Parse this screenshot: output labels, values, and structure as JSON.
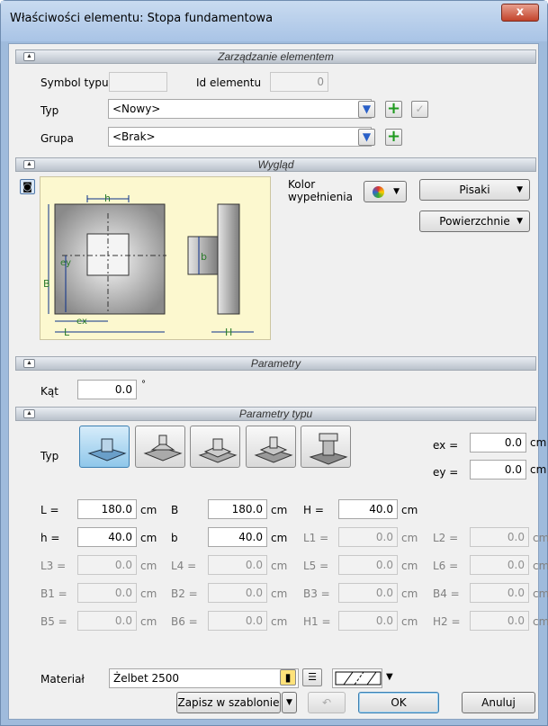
{
  "window": {
    "title": "Właściwości elementu: Stopa fundamentowa",
    "close_glyph": "x"
  },
  "sections": {
    "zarzadzanie": "Zarządzanie elementem",
    "wyglad": "Wygląd",
    "parametry": "Parametry",
    "parametry_typu": "Parametry typu"
  },
  "zarzadzanie": {
    "symbol_label": "Symbol typu",
    "symbol_value": "",
    "id_label": "Id elementu",
    "id_value": "0",
    "typ_label": "Typ",
    "typ_value": "<Nowy>",
    "grupa_label": "Grupa",
    "grupa_value": "<Brak>"
  },
  "wyglad": {
    "kolor_label_1": "Kolor",
    "kolor_label_2": "wypełnienia",
    "pisaki_label": "Pisaki",
    "powierzchnie_label": "Powierzchnie",
    "diagram_labels": {
      "h": "h",
      "b": "b",
      "B": "B",
      "ey": "ey",
      "ex": "ex",
      "L": "L",
      "H": "H"
    }
  },
  "parametry": {
    "kat_label": "Kąt",
    "kat_value": "0.0",
    "kat_unit": "°"
  },
  "parametry_typu": {
    "typ_label": "Typ",
    "ex_label": "ex =",
    "ex_value": "0.0",
    "ex_unit": "cm",
    "ey_label": "ey =",
    "ey_value": "0.0",
    "ey_unit": "cm",
    "params": [
      {
        "label": "L =",
        "value": "180.0",
        "unit": "cm",
        "enabled": true
      },
      {
        "label": "B",
        "value": "180.0",
        "unit": "cm",
        "enabled": true
      },
      {
        "label": "H =",
        "value": "40.0",
        "unit": "cm",
        "enabled": true
      },
      {
        "label": "h =",
        "value": "40.0",
        "unit": "cm",
        "enabled": true
      },
      {
        "label": "b",
        "value": "40.0",
        "unit": "cm",
        "enabled": true
      },
      {
        "label": "L1 =",
        "value": "0.0",
        "unit": "cm",
        "enabled": false
      },
      {
        "label": "L2 =",
        "value": "0.0",
        "unit": "cm",
        "enabled": false
      },
      {
        "label": "L3 =",
        "value": "0.0",
        "unit": "cm",
        "enabled": false
      },
      {
        "label": "L4 =",
        "value": "0.0",
        "unit": "cm",
        "enabled": false
      },
      {
        "label": "L5 =",
        "value": "0.0",
        "unit": "cm",
        "enabled": false
      },
      {
        "label": "L6 =",
        "value": "0.0",
        "unit": "cm",
        "enabled": false
      },
      {
        "label": "B1 =",
        "value": "0.0",
        "unit": "cm",
        "enabled": false
      },
      {
        "label": "B2 =",
        "value": "0.0",
        "unit": "cm",
        "enabled": false
      },
      {
        "label": "B3 =",
        "value": "0.0",
        "unit": "cm",
        "enabled": false
      },
      {
        "label": "B4 =",
        "value": "0.0",
        "unit": "cm",
        "enabled": false
      },
      {
        "label": "B5 =",
        "value": "0.0",
        "unit": "cm",
        "enabled": false
      },
      {
        "label": "B6 =",
        "value": "0.0",
        "unit": "cm",
        "enabled": false
      },
      {
        "label": "H1 =",
        "value": "0.0",
        "unit": "cm",
        "enabled": false
      },
      {
        "label": "H2 =",
        "value": "0.0",
        "unit": "cm",
        "enabled": false
      }
    ],
    "material_label": "Materiał",
    "material_value": "Żelbet 2500"
  },
  "footer": {
    "zapisz_label": "Zapisz w szablonie",
    "ok_label": "OK",
    "anuluj_label": "Anuluj"
  }
}
